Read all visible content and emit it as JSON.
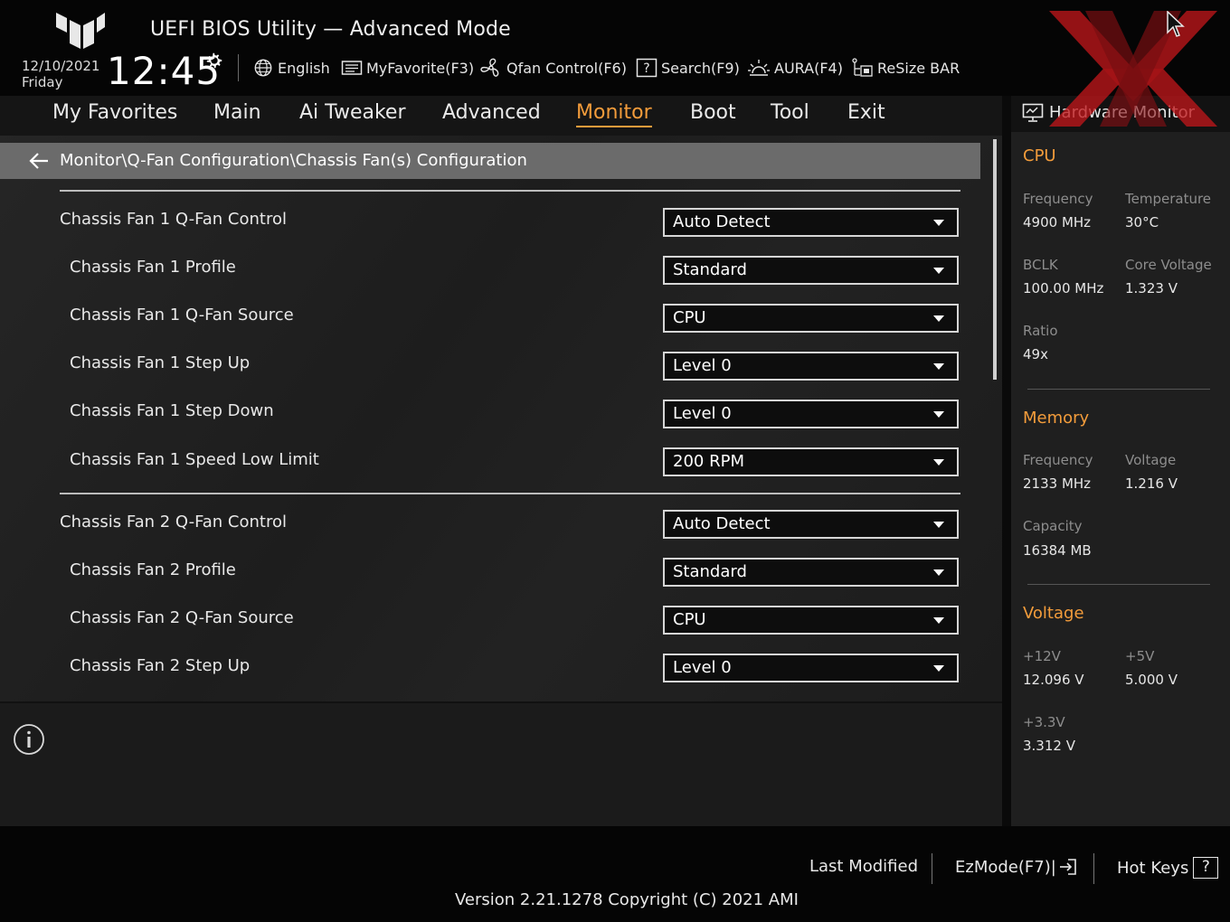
{
  "header": {
    "title": "UEFI BIOS Utility — Advanced Mode",
    "date": "12/10/2021",
    "day": "Friday",
    "time": "12:45",
    "tools": [
      {
        "label": "English",
        "icon": "globe-icon"
      },
      {
        "label": "MyFavorite(F3)",
        "icon": "favorite-list-icon"
      },
      {
        "label": "Qfan Control(F6)",
        "icon": "fan-icon"
      },
      {
        "label": "Search(F9)",
        "icon": "search-help-icon"
      },
      {
        "label": "AURA(F4)",
        "icon": "aura-light-icon"
      },
      {
        "label": "ReSize BAR",
        "icon": "resize-bar-icon"
      }
    ]
  },
  "nav": {
    "tabs": [
      {
        "label": "My Favorites"
      },
      {
        "label": "Main"
      },
      {
        "label": "Ai Tweaker"
      },
      {
        "label": "Advanced"
      },
      {
        "label": "Monitor",
        "active": true
      },
      {
        "label": "Boot"
      },
      {
        "label": "Tool"
      },
      {
        "label": "Exit"
      }
    ]
  },
  "breadcrumb": "Monitor\\Q-Fan Configuration\\Chassis Fan(s) Configuration",
  "settings": [
    {
      "label": "Chassis Fan 1 Q-Fan Control",
      "value": "Auto Detect"
    },
    {
      "label": "Chassis Fan 1 Profile",
      "value": "Standard"
    },
    {
      "label": "Chassis Fan 1 Q-Fan Source",
      "value": "CPU"
    },
    {
      "label": "Chassis Fan 1 Step Up",
      "value": "Level 0"
    },
    {
      "label": "Chassis Fan 1 Step Down",
      "value": "Level 0"
    },
    {
      "label": "Chassis Fan 1 Speed Low Limit",
      "value": "200 RPM"
    },
    {
      "label": "Chassis Fan 2 Q-Fan Control",
      "value": "Auto Detect"
    },
    {
      "label": "Chassis Fan 2 Profile",
      "value": "Standard"
    },
    {
      "label": "Chassis Fan 2 Q-Fan Source",
      "value": "CPU"
    },
    {
      "label": "Chassis Fan 2 Step Up",
      "value": "Level 0"
    }
  ],
  "hardware_monitor": {
    "title": "Hardware Monitor",
    "cpu": {
      "heading": "CPU",
      "frequency_label": "Frequency",
      "frequency": "4900 MHz",
      "temperature_label": "Temperature",
      "temperature": "30°C",
      "bclk_label": "BCLK",
      "bclk": "100.00 MHz",
      "core_voltage_label": "Core Voltage",
      "core_voltage": "1.323 V",
      "ratio_label": "Ratio",
      "ratio": "49x"
    },
    "memory": {
      "heading": "Memory",
      "frequency_label": "Frequency",
      "frequency": "2133 MHz",
      "voltage_label": "Voltage",
      "voltage": "1.216 V",
      "capacity_label": "Capacity",
      "capacity": "16384 MB"
    },
    "voltage": {
      "heading": "Voltage",
      "v12_label": "+12V",
      "v12": "12.096 V",
      "v5_label": "+5V",
      "v5": "5.000 V",
      "v33_label": "+3.3V",
      "v33": "3.312 V"
    }
  },
  "footer": {
    "last_modified": "Last Modified",
    "ezmode": "EzMode(F7)|",
    "hotkeys": "Hot Keys",
    "hotkeys_key": "?",
    "version": "Version 2.21.1278 Copyright (C) 2021 AMI"
  },
  "colors": {
    "accent": "#f39c3b",
    "watermark": "#c0161b"
  }
}
